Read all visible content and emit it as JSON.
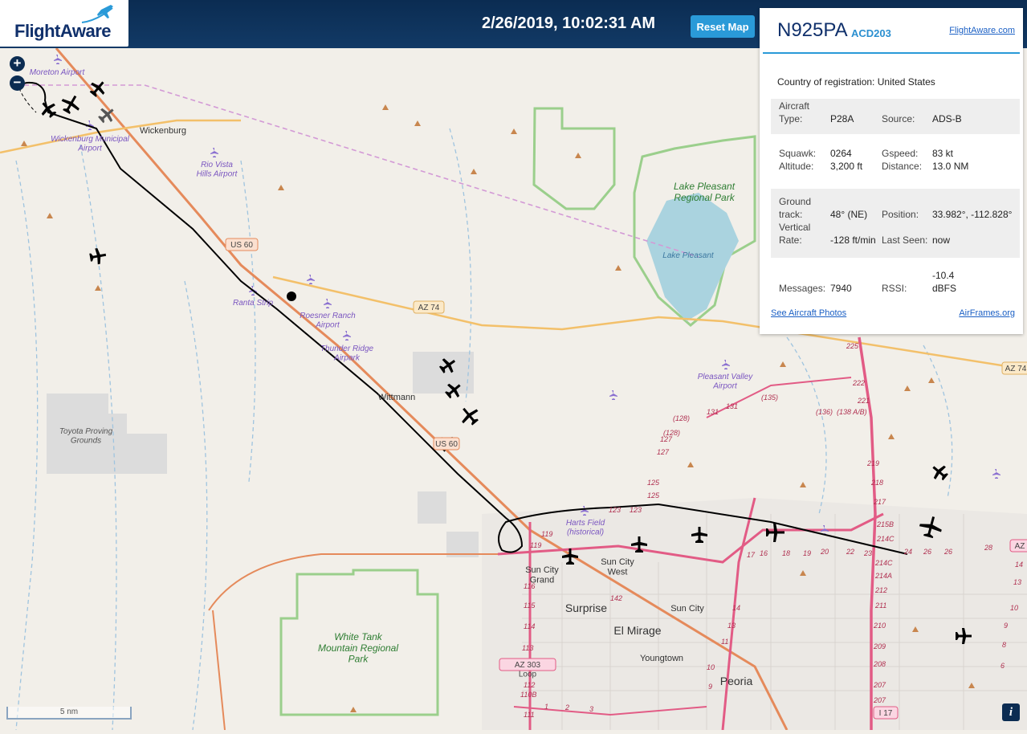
{
  "header": {
    "logo_text": "FlightAware",
    "timestamp": "2/26/2019, 10:02:31 AM",
    "reset_button": "Reset Map"
  },
  "zoom": {
    "in_label": "+",
    "out_label": "−"
  },
  "panel": {
    "tail": "N925PA",
    "ident": "ACD203",
    "flightaware_link": "FlightAware.com",
    "country_label": "Country of registration:",
    "country_value": "United States",
    "aircraft_type_label": "Aircraft Type:",
    "aircraft_type_value": "P28A",
    "source_label": "Source:",
    "source_value": "ADS-B",
    "squawk_label": "Squawk:",
    "squawk_value": "0264",
    "gspeed_label": "Gspeed:",
    "gspeed_value": "83 kt",
    "altitude_label": "Altitude:",
    "altitude_value": "3,200 ft",
    "distance_label": "Distance:",
    "distance_value": "13.0 NM",
    "ground_track_label": "Ground track:",
    "ground_track_value": "48° (NE)",
    "position_label": "Position:",
    "position_value": "33.982°, -112.828°",
    "vertical_rate_label": "Vertical Rate:",
    "vertical_rate_value": "-128 ft/min",
    "last_seen_label": "Last Seen:",
    "last_seen_value": "now",
    "messages_label": "Messages:",
    "messages_value": "7940",
    "rssi_label": "RSSI:",
    "rssi_value": "-10.4 dBFS",
    "photos_link": "See Aircraft Photos",
    "airframes_link": "AirFrames.org"
  },
  "map_labels": {
    "moreton": "Moreton Airport",
    "wickenburg": "Wickenburg",
    "wickenburg_airport": "Wickenburg Municipal Airport",
    "rio_vista": "Rio Vista Hills Airport",
    "us60": "US 60",
    "az74": "AZ 74",
    "ranta": "Ranta Strip",
    "roesner": "Roesner Ranch Airport",
    "thunder": "Thunder Ridge Airpark",
    "lake_pleasant_park": "Lake Pleasant Regional Park",
    "lake_pleasant": "Lake Pleasant",
    "pleasant_valley": "Pleasant Valley Airport",
    "toyota": "Toyota Proving Grounds",
    "wittmann": "Wittmann",
    "us60b": "US 60",
    "harts": "Harts Field (historical)",
    "sun_city_grand": "Sun City Grand",
    "sun_city_west": "Sun City West",
    "surprise": "Surprise",
    "el_mirage": "El Mirage",
    "sun_city": "Sun City",
    "youngtown": "Youngtown",
    "peoria": "Peoria",
    "white_tank": "White Tank Mountain Regional Park",
    "az303": "AZ 303 Loop",
    "i17": "I 17",
    "az74b": "AZ 74",
    "az_right": "AZ"
  },
  "scale": {
    "label": "5 nm"
  },
  "info_button": "i",
  "colors": {
    "header_bg": "#0b2c52",
    "accent": "#2a9ad8",
    "map_bg": "#f2efe9",
    "park_border": "#9bcf8c",
    "water": "#aad3df",
    "highway": "#e58a5b",
    "arterial": "#f3c06a",
    "freeway": "#e25b85",
    "track": "#000000",
    "airport": "#8a6fd0"
  }
}
